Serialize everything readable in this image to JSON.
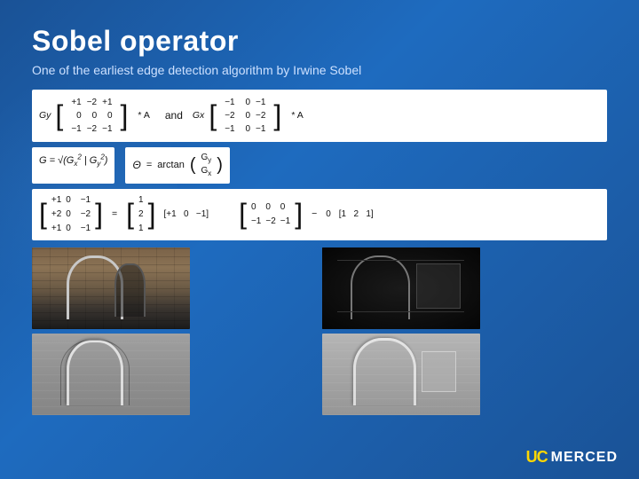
{
  "slide": {
    "title": "Sobel operator",
    "subtitle": "One of the earliest edge detection algorithm by Irwine Sobel",
    "formula_section": {
      "gy_label": "Gy",
      "gx_label": "Gx",
      "and_text": "and",
      "star_a": "* A",
      "gy_matrix": [
        [
          "+1",
          "-2",
          "+1"
        ],
        [
          "0",
          "0",
          "0"
        ],
        [
          "-1",
          "-2",
          "-1"
        ]
      ],
      "gx_matrix": [
        [
          "-1",
          "0",
          "-1"
        ],
        [
          "-2",
          "0",
          "-2"
        ],
        [
          "-1",
          "0",
          "-1"
        ]
      ],
      "gradient_formula": "G = √(Gx² | Gy²)",
      "theta_label": "Θ",
      "arctan_formula": "arctan(Gy/Gx)",
      "row2_matrix1": [
        [
          "+1",
          "0",
          "-1"
        ],
        [
          "+2",
          "0",
          "-2"
        ],
        [
          "+1",
          "0",
          "-1"
        ]
      ],
      "row2_val1": "2",
      "row2_matrix2": [
        "1",
        "0",
        "-1"
      ],
      "row2_matrix3": [
        [
          "0",
          "0",
          "0"
        ],
        [
          "-1",
          "-2",
          "-1"
        ]
      ],
      "row2_val2": "0",
      "row2_matrix4": [
        "1",
        "2",
        "1"
      ]
    },
    "images": [
      {
        "id": "color-photo",
        "type": "color",
        "desc": "Original color photo of brick arch and bicycle"
      },
      {
        "id": "dark-photo",
        "type": "dark",
        "desc": "Dark/night version photo"
      },
      {
        "id": "gray-emboss1",
        "type": "gray-emboss",
        "desc": "Gray embossed Sobel filtered image 1"
      },
      {
        "id": "gray-emboss2",
        "type": "gray-emboss2",
        "desc": "Gray embossed Sobel filtered image 2"
      }
    ],
    "logo": {
      "uc": "UC",
      "merced": "MERCED"
    }
  }
}
